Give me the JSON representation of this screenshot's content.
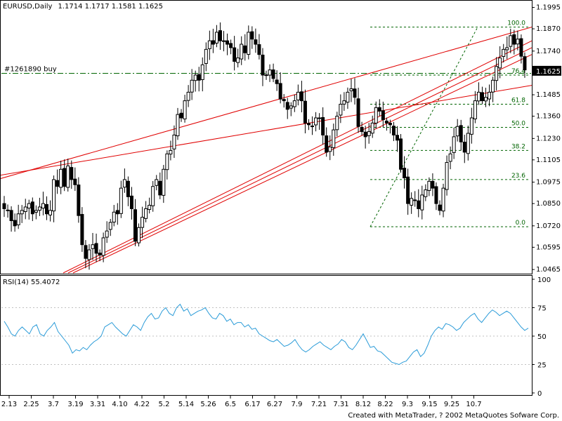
{
  "chart_data": {
    "type": "candlestick",
    "header": {
      "symbol": "EURUSD,Daily",
      "ohlc": "1.1714 1.1717 1.1581 1.1625"
    },
    "order_label": "#1261890 buy",
    "order_price": 1.161,
    "last_price_label": "1.1625",
    "last_price": 1.1625,
    "price_ylim": [
      1.0445,
      1.203
    ],
    "price_ticks": [
      {
        "v": 1.1995,
        "l": "1.1995"
      },
      {
        "v": 1.187,
        "l": "1.1870"
      },
      {
        "v": 1.174,
        "l": "1.1740"
      },
      {
        "v": 1.1485,
        "l": "1.1485"
      },
      {
        "v": 1.136,
        "l": "1.1360"
      },
      {
        "v": 1.123,
        "l": "1.1230"
      },
      {
        "v": 1.1105,
        "l": "1.1105"
      },
      {
        "v": 1.0975,
        "l": "1.0975"
      },
      {
        "v": 1.085,
        "l": "1.0850"
      },
      {
        "v": 1.072,
        "l": "1.0720"
      },
      {
        "v": 1.0595,
        "l": "1.0595"
      },
      {
        "v": 1.0465,
        "l": "1.0465"
      }
    ],
    "fibonacci": [
      {
        "level": "100.0",
        "price": 1.188
      },
      {
        "level": "76.4",
        "price": 1.16
      },
      {
        "level": "61.8",
        "price": 1.143
      },
      {
        "level": "50.0",
        "price": 1.1295
      },
      {
        "level": "38.2",
        "price": 1.116
      },
      {
        "level": "23.6",
        "price": 1.099
      },
      {
        "level": "0.0",
        "price": 1.0715
      }
    ],
    "x_ticks": [
      "2.13",
      "2.25",
      "3.7",
      "3.19",
      "3.31",
      "4.10",
      "4.22",
      "5.2",
      "5.14",
      "5.26",
      "6.5",
      "6.17",
      "6.27",
      "7.9",
      "7.21",
      "7.31",
      "8.12",
      "8.22",
      "9.3",
      "9.15",
      "9.25",
      "10.7"
    ],
    "close_series": [
      1.082,
      1.081,
      1.075,
      1.072,
      1.079,
      1.081,
      1.083,
      1.085,
      1.079,
      1.081,
      1.083,
      1.085,
      1.079,
      1.081,
      1.099,
      1.095,
      1.105,
      1.095,
      1.107,
      1.099,
      1.096,
      1.078,
      1.061,
      1.053,
      1.058,
      1.061,
      1.056,
      1.055,
      1.065,
      1.069,
      1.074,
      1.08,
      1.079,
      1.094,
      1.099,
      1.089,
      1.082,
      1.063,
      1.071,
      1.077,
      1.082,
      1.084,
      1.095,
      1.099,
      1.09,
      1.105,
      1.114,
      1.116,
      1.125,
      1.137,
      1.135,
      1.145,
      1.15,
      1.157,
      1.16,
      1.157,
      1.166,
      1.175,
      1.18,
      1.178,
      1.185,
      1.18,
      1.18,
      1.178,
      1.176,
      1.168,
      1.17,
      1.178,
      1.173,
      1.185,
      1.181,
      1.178,
      1.172,
      1.16,
      1.16,
      1.163,
      1.158,
      1.155,
      1.146,
      1.145,
      1.14,
      1.142,
      1.145,
      1.15,
      1.145,
      1.132,
      1.131,
      1.13,
      1.135,
      1.135,
      1.125,
      1.115,
      1.118,
      1.128,
      1.136,
      1.143,
      1.145,
      1.15,
      1.152,
      1.147,
      1.13,
      1.127,
      1.124,
      1.127,
      1.132,
      1.141,
      1.139,
      1.134,
      1.132,
      1.131,
      1.125,
      1.122,
      1.105,
      1.1,
      1.085,
      1.088,
      1.087,
      1.082,
      1.09,
      1.093,
      1.098,
      1.094,
      1.085,
      1.081,
      1.094,
      1.109,
      1.114,
      1.124,
      1.13,
      1.121,
      1.115,
      1.126,
      1.135,
      1.145,
      1.15,
      1.145,
      1.147,
      1.15,
      1.157,
      1.165,
      1.17,
      1.175,
      1.176,
      1.183,
      1.178,
      1.181,
      1.171,
      1.163
    ],
    "rsi": {
      "label": "RSI(14) 55.4072",
      "ylim": [
        0,
        100
      ],
      "ticks": [
        {
          "v": 100,
          "l": "100"
        },
        {
          "v": 75,
          "l": "75"
        },
        {
          "v": 50,
          "l": "50"
        },
        {
          "v": 25,
          "l": "25"
        },
        {
          "v": 0,
          "l": "0"
        }
      ],
      "values": [
        63,
        58,
        52,
        50,
        55,
        58,
        55,
        52,
        58,
        60,
        52,
        50,
        55,
        58,
        62,
        54,
        50,
        46,
        42,
        35,
        38,
        37,
        40,
        38,
        42,
        45,
        47,
        50,
        58,
        60,
        62,
        58,
        55,
        52,
        50,
        55,
        60,
        58,
        55,
        62,
        67,
        70,
        65,
        66,
        72,
        75,
        70,
        68,
        75,
        78,
        72,
        74,
        68,
        70,
        72,
        73,
        75,
        70,
        66,
        65,
        70,
        68,
        63,
        65,
        60,
        62,
        62,
        58,
        60,
        56,
        57,
        52,
        50,
        48,
        46,
        45,
        47,
        44,
        41,
        42,
        44,
        47,
        42,
        38,
        36,
        38,
        41,
        43,
        45,
        42,
        40,
        38,
        41,
        43,
        47,
        45,
        40,
        38,
        42,
        47,
        52,
        46,
        40,
        41,
        37,
        36,
        33,
        30,
        27,
        26,
        25,
        27,
        28,
        32,
        36,
        38,
        32,
        35,
        42,
        50,
        55,
        58,
        56,
        61,
        60,
        58,
        55,
        57,
        62,
        65,
        68,
        70,
        65,
        62,
        66,
        70,
        73,
        71,
        68,
        70,
        72,
        70,
        66,
        62,
        58,
        55,
        57
      ]
    },
    "footer": "Created with MetaTrader, ? 2002 MetaQuotes Sofware Corp."
  }
}
